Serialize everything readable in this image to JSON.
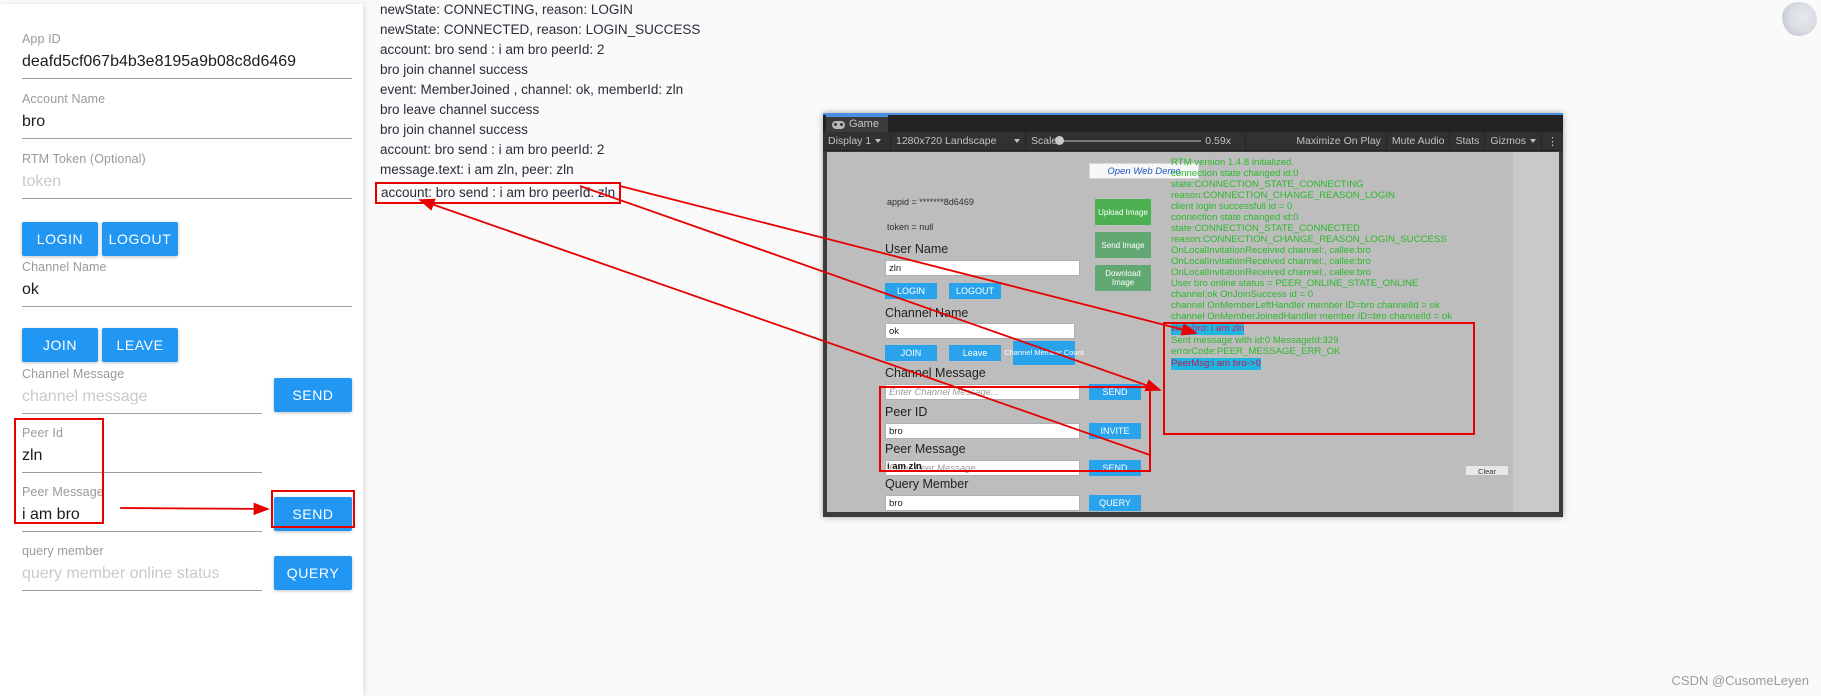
{
  "left_form": {
    "fields": [
      {
        "label": "App ID",
        "value": "deafd5cf067b4b3e8195a9b08c8d6469",
        "is_placeholder": false
      },
      {
        "label": "Account Name",
        "value": "bro",
        "is_placeholder": false
      },
      {
        "label": "RTM Token (Optional)",
        "value": "token",
        "is_placeholder": true
      },
      {
        "label": "Channel Name",
        "value": "ok",
        "is_placeholder": false
      },
      {
        "label": "Channel Message",
        "value": "channel message",
        "is_placeholder": true
      },
      {
        "label": "Peer Id",
        "value": "zln",
        "is_placeholder": false
      },
      {
        "label": "Peer Message",
        "value": "i am bro",
        "is_placeholder": false
      },
      {
        "label": "query member",
        "value": "query member online status",
        "is_placeholder": true
      }
    ],
    "buttons": {
      "login": "LOGIN",
      "logout": "LOGOUT",
      "join": "JOIN",
      "leave": "LEAVE",
      "send_channel": "SEND",
      "send_peer": "SEND",
      "query": "QUERY"
    }
  },
  "log_lines": [
    {
      "text": "newState: CONNECTING, reason: LOGIN",
      "boxed": false
    },
    {
      "text": "newState: CONNECTED, reason: LOGIN_SUCCESS",
      "boxed": false
    },
    {
      "text": "account: bro send : i am bro peerId: 2",
      "boxed": false
    },
    {
      "text": "bro join channel success",
      "boxed": false
    },
    {
      "text": "event: MemberJoined , channel: ok, memberId: zln",
      "boxed": false
    },
    {
      "text": "bro leave channel success",
      "boxed": false
    },
    {
      "text": "bro join channel success",
      "boxed": false
    },
    {
      "text": "account: bro send : i am bro peerId: 2",
      "boxed": false
    },
    {
      "text": "message.text: i am zln, peer: zln",
      "boxed": false
    },
    {
      "text": "account: bro send : i am bro peerId: zln",
      "boxed": true
    }
  ],
  "unity": {
    "tab_label": "Game",
    "tab_icon": "gamepad-icon",
    "toolbar": {
      "display": "Display 1",
      "resolution": "1280x720 Landscape",
      "scale_label": "Scale",
      "scale_value": "0.59x",
      "maximize_on_play": "Maximize On Play",
      "mute_audio": "Mute Audio",
      "stats": "Stats",
      "gizmos": "Gizmos",
      "kebab": "⋮"
    },
    "webgl_form": {
      "open_web_demo": "Open Web Demo",
      "appid_text": "appid = *******8d6469",
      "token_text": "token = null",
      "user_name_label": "User Name",
      "user_name_value": "zln",
      "login": "LOGIN",
      "logout": "LOGOUT",
      "channel_name_label": "Channel Name",
      "channel_name_value": "ok",
      "join": "JOIN",
      "leave": "Leave",
      "channel_member_count": "Channel Member Count",
      "channel_message_label": "Channel Message",
      "channel_message_placeholder": "Enter Channel Message...",
      "send_channel": "SEND",
      "peer_id_label": "Peer ID",
      "peer_id_value": "bro",
      "invite": "INVITE",
      "peer_message_label": "Peer Message",
      "peer_message_placeholder": "Enter Peer Message...",
      "peer_message_overlay": "i am zln",
      "send_peer": "SEND",
      "query_member_label": "Query Member",
      "query_member_value": "bro",
      "query": "QUERY",
      "upload_image": "Upload Image",
      "send_image": "Send Image",
      "download_image": "Download Image",
      "clear": "Clear"
    },
    "console_lines": [
      {
        "text": "RTM version 1.4.8 initialized.",
        "style": "green"
      },
      {
        "text": "connection state changed id:0",
        "style": "green"
      },
      {
        "text": "state:CONNECTION_STATE_CONNECTING",
        "style": "green"
      },
      {
        "text": "reason:CONNECTION_CHANGE_REASON_LOGIN",
        "style": "green"
      },
      {
        "text": "client login successfull id = 0",
        "style": "green"
      },
      {
        "text": "connection state changed id:0",
        "style": "green"
      },
      {
        "text": "state:CONNECTION_STATE_CONNECTED",
        "style": "green"
      },
      {
        "text": "reason:CONNECTION_CHANGE_REASON_LOGIN_SUCCESS",
        "style": "green"
      },
      {
        "text": "OnLocalInvitationReceived channel:, callee:bro",
        "style": "green"
      },
      {
        "text": "OnLocalInvitationReceived channel:, callee:bro",
        "style": "green"
      },
      {
        "text": "OnLocalInvitationReceived channel:, callee:bro",
        "style": "green"
      },
      {
        "text": "User bro online status = PEER_ONLINE_STATE_ONLINE",
        "style": "green"
      },
      {
        "text": "channel:ok OnJoinSuccess id = 0",
        "style": "green"
      },
      {
        "text": "channel OnMemberLeftHandler member ID=bro channelId = ok",
        "style": "green"
      },
      {
        "text": "channel OnMemberJoinedHandler member ID=bro channelId = ok",
        "style": "green"
      },
      {
        "text": "zln->bro: i am zln",
        "style": "highlight-cyan"
      },
      {
        "text": "Sent message with id:0 MessageId:329",
        "style": "green"
      },
      {
        "text": "errorCode:PEER_MESSAGE_ERR_OK",
        "style": "green"
      },
      {
        "text": "PeerMsg:i am bro->0",
        "style": "highlight-magenta"
      }
    ]
  },
  "watermark": "CSDN @CusomeLeyen",
  "colors": {
    "accent_blue": "#2196f3",
    "annotation_red": "#e60000",
    "console_green": "#2cb92c",
    "highlight_cyan": "#1cb6e0",
    "magenta": "#d81b60"
  }
}
